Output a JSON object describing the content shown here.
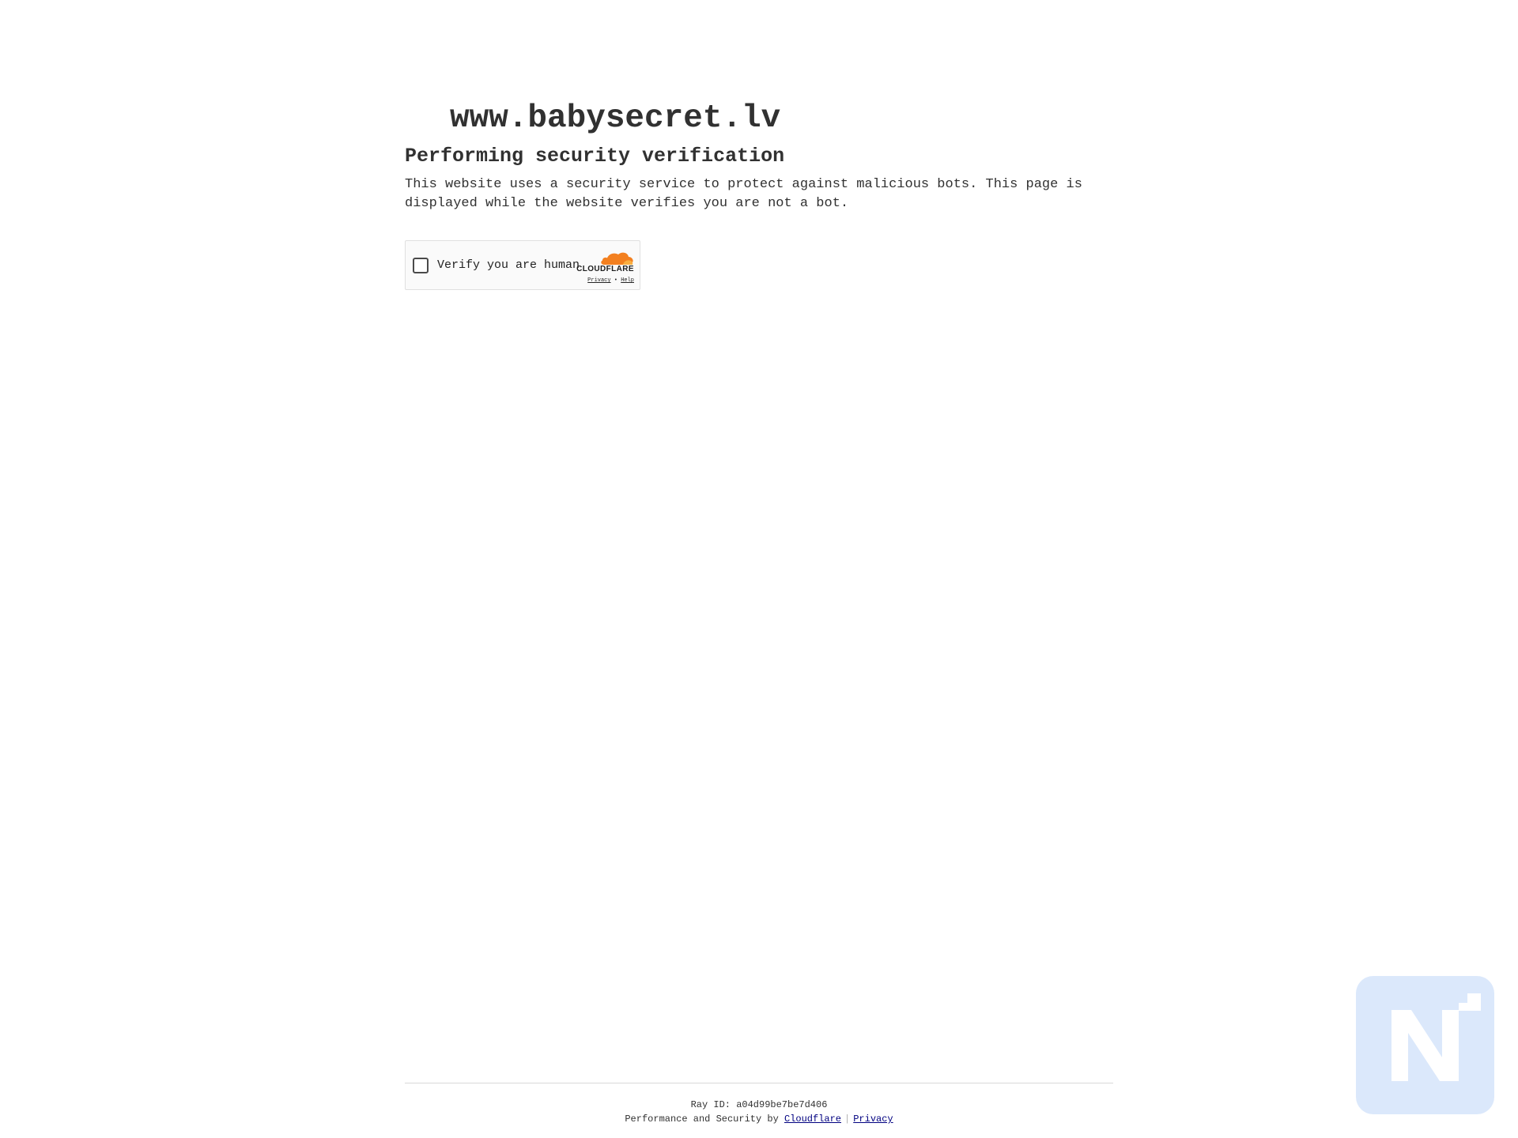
{
  "page": {
    "site_name": "www.babysecret.lv",
    "heading": "Performing security verification",
    "description": "This website uses a security service to protect against malicious bots. This page is displayed while the website verifies you are not a bot."
  },
  "widget": {
    "label": "Verify you are human",
    "brand": "CLOUDFLARE",
    "privacy_link": "Privacy",
    "link_separator": "•",
    "help_link": "Help",
    "brand_color": "#f38020"
  },
  "footer": {
    "ray_id": "Ray ID: a04d99be7be7d406",
    "performance_text": "Performance and Security by",
    "cloudflare_link": "Cloudflare",
    "separator": "|",
    "privacy_link": "Privacy",
    "link_color": "#000080"
  },
  "overlay": {
    "badge_icon": "n-logo-icon",
    "badge_color": "#dbe8fb"
  }
}
